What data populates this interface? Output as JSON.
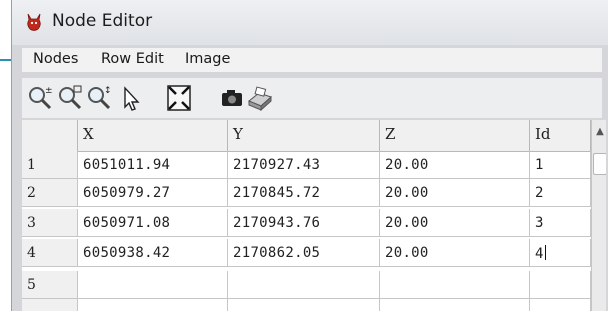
{
  "window": {
    "title": "Node Editor",
    "app_icon": "devil-icon"
  },
  "menu": [
    {
      "label": "Nodes"
    },
    {
      "label": "Row Edit"
    },
    {
      "label": "Image"
    }
  ],
  "toolbar": {
    "tools": [
      "zoom-in-icon",
      "zoom-out-icon",
      "zoom-pan-icon",
      "pointer-icon",
      "zoom-extent-icon",
      "camera-icon",
      "print-icon"
    ]
  },
  "table": {
    "columns": [
      "X",
      "Y",
      "Z",
      "Id"
    ],
    "rows": [
      {
        "num": "1",
        "x": "6051011.94",
        "y": "2170927.43",
        "z": "20.00",
        "id": "1"
      },
      {
        "num": "2",
        "x": "6050979.27",
        "y": "2170845.72",
        "z": "20.00",
        "id": "2"
      },
      {
        "num": "3",
        "x": "6050971.08",
        "y": "2170943.76",
        "z": "20.00",
        "id": "3"
      },
      {
        "num": "4",
        "x": "6050938.42",
        "y": "2170862.05",
        "z": "20.00",
        "id": "4"
      },
      {
        "num": "5",
        "x": "",
        "y": "",
        "z": "",
        "id": ""
      }
    ]
  }
}
